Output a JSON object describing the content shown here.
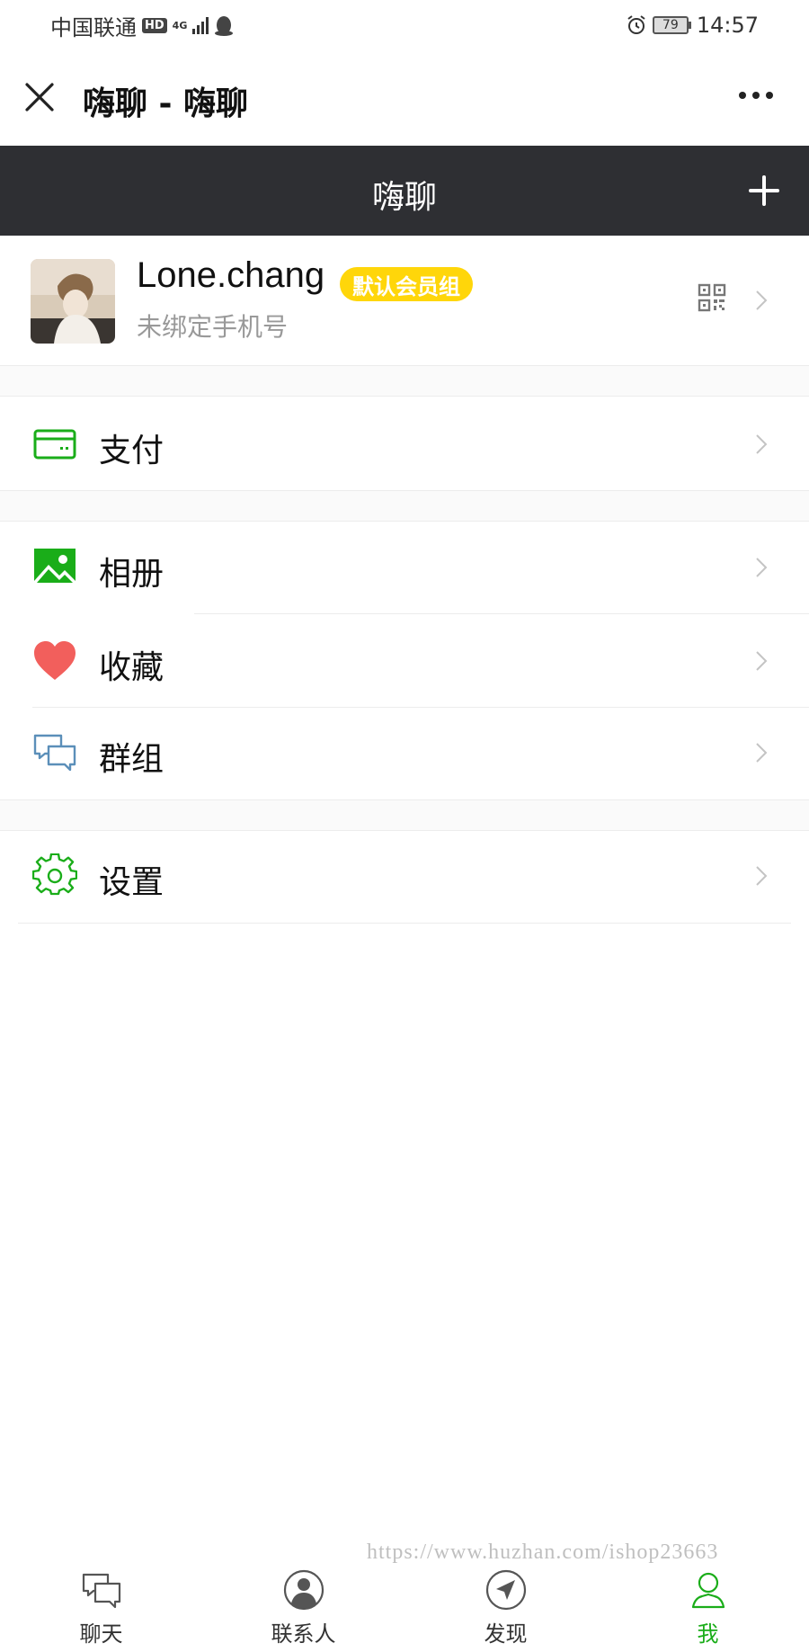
{
  "status_bar": {
    "carrier": "中国联通",
    "hd": "HD",
    "network": "4G",
    "battery": "79",
    "time": "14:57"
  },
  "title_bar": {
    "title": "嗨聊 - 嗨聊"
  },
  "app_header": {
    "title": "嗨聊"
  },
  "profile": {
    "username": "Lone.chang",
    "member_group": "默认会员组",
    "phone_status": "未绑定手机号"
  },
  "menu": [
    {
      "label": "支付",
      "icon": "wallet-icon"
    },
    {
      "label": "相册",
      "icon": "photo-icon"
    },
    {
      "label": "收藏",
      "icon": "heart-icon"
    },
    {
      "label": "群组",
      "icon": "group-chat-icon"
    },
    {
      "label": "设置",
      "icon": "gear-icon"
    }
  ],
  "watermark": "https://www.huzhan.com/ishop23663",
  "tabs": [
    {
      "label": "聊天",
      "icon": "chat-icon"
    },
    {
      "label": "联系人",
      "icon": "contacts-icon"
    },
    {
      "label": "发现",
      "icon": "discover-icon"
    },
    {
      "label": "我",
      "icon": "me-icon",
      "active": true
    }
  ],
  "colors": {
    "header_bg": "#2e2f33",
    "accent_green": "#1aad19",
    "badge_yellow": "#ffd60a",
    "heart_red": "#f25f5c"
  }
}
